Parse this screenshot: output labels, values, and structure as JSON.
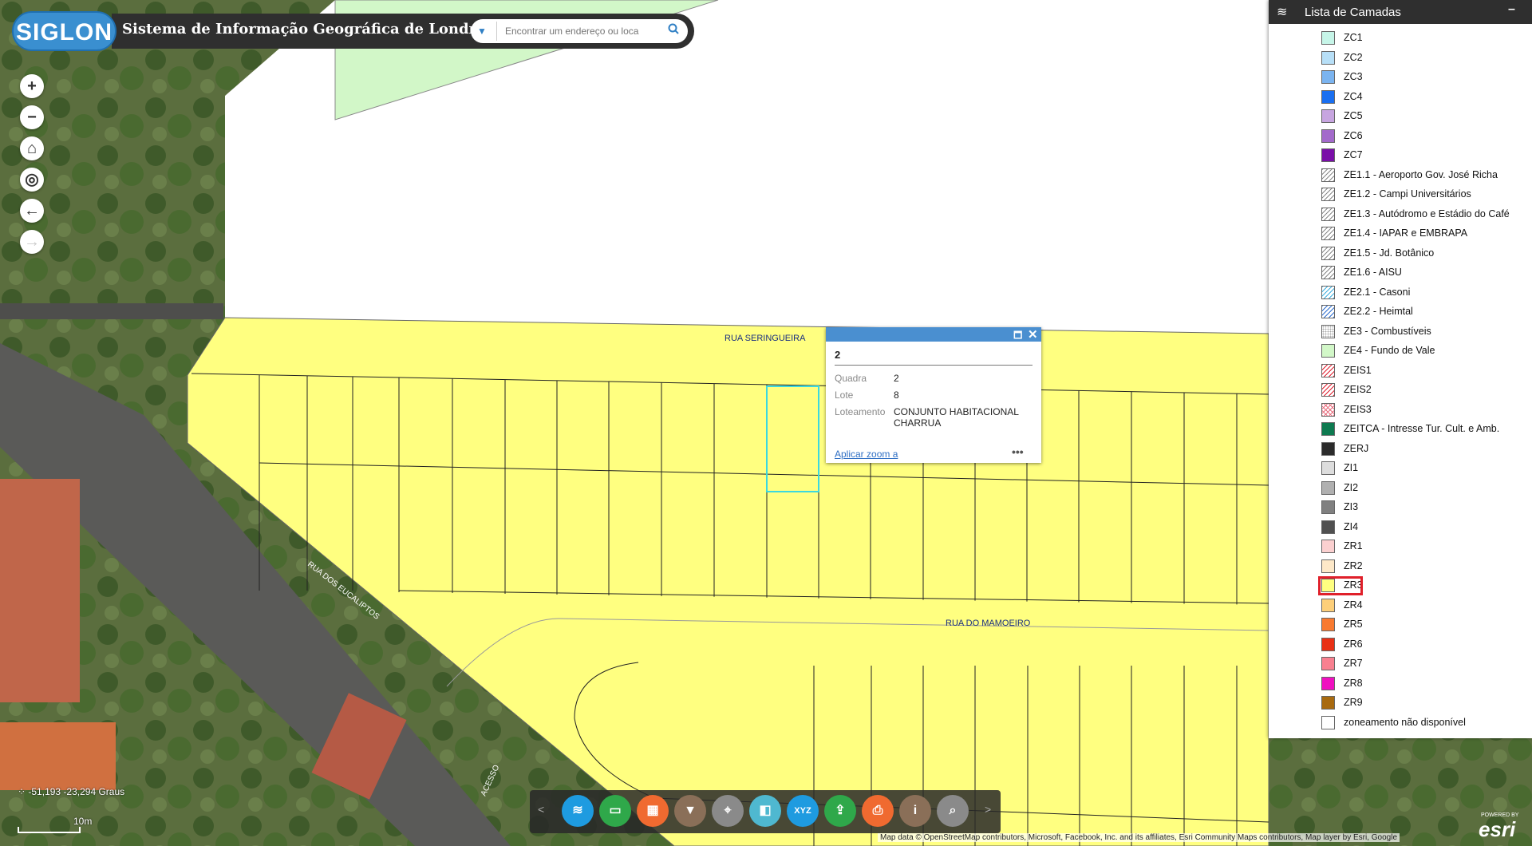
{
  "header": {
    "logo_text": "SIGLON",
    "title": "Sistema de Informação Geográfica de Londrina",
    "search_placeholder": "Encontrar um endereço ou loca",
    "search_dropdown_icon": "caret-down-icon",
    "search_icon": "search-icon"
  },
  "map_controls": [
    {
      "name": "zoom-in-button",
      "glyph": "+"
    },
    {
      "name": "zoom-out-button",
      "glyph": "−"
    },
    {
      "name": "home-button",
      "glyph": "⌂"
    },
    {
      "name": "locate-button",
      "glyph": "◎"
    },
    {
      "name": "back-extent-button",
      "glyph": "←"
    },
    {
      "name": "forward-extent-button",
      "glyph": "→"
    }
  ],
  "streets": {
    "seringueira": "RUA SERINGUEIRA",
    "mamoeiro": "RUA DO MAMOEIRO",
    "eucaliptos": "RUA DOS EUCALIPTOS",
    "acesso": "ACESSO"
  },
  "popup": {
    "title": "2",
    "fields": [
      {
        "key": "Quadra",
        "value": "2"
      },
      {
        "key": "Lote",
        "value": "8"
      },
      {
        "key": "Loteamento",
        "value": "CONJUNTO HABITACIONAL CHARRUA"
      }
    ],
    "zoom_link": "Aplicar zoom a",
    "more": "•••"
  },
  "layer_panel": {
    "title": "Lista de Camadas",
    "minimize": "–",
    "highlighted": "ZR3",
    "layers": [
      {
        "label": "ZC1",
        "color": "#c6f5e8",
        "pattern": "solid"
      },
      {
        "label": "ZC2",
        "color": "#b7dff7",
        "pattern": "solid"
      },
      {
        "label": "ZC3",
        "color": "#7bb4f0",
        "pattern": "solid"
      },
      {
        "label": "ZC4",
        "color": "#1a6ff0",
        "pattern": "solid"
      },
      {
        "label": "ZC5",
        "color": "#c7a5e0",
        "pattern": "solid"
      },
      {
        "label": "ZC6",
        "color": "#a36acb",
        "pattern": "solid"
      },
      {
        "label": "ZC7",
        "color": "#7a0fa8",
        "pattern": "solid"
      },
      {
        "label": "ZE1.1 - Aeroporto Gov. José Richa",
        "color": "#888888",
        "pattern": "hatch"
      },
      {
        "label": "ZE1.2 - Campi Universitários",
        "color": "#888888",
        "pattern": "hatch"
      },
      {
        "label": "ZE1.3 - Autódromo e Estádio do Café",
        "color": "#888888",
        "pattern": "hatch"
      },
      {
        "label": "ZE1.4 - IAPAR e EMBRAPA",
        "color": "#888888",
        "pattern": "hatch"
      },
      {
        "label": "ZE1.5 - Jd. Botânico",
        "color": "#888888",
        "pattern": "hatch"
      },
      {
        "label": "ZE1.6 - AISU",
        "color": "#888888",
        "pattern": "hatch"
      },
      {
        "label": "ZE2.1 - Casoni",
        "color": "#3fb0e0",
        "pattern": "hatch"
      },
      {
        "label": "ZE2.2 - Heimtal",
        "color": "#2f6fd0",
        "pattern": "hatch"
      },
      {
        "label": "ZE3 - Combustíveis",
        "color": "#aaaaaa",
        "pattern": "dots"
      },
      {
        "label": "ZE4 - Fundo de Vale",
        "color": "#d2f7c8",
        "pattern": "solid"
      },
      {
        "label": "ZEIS1",
        "color": "#e02030",
        "pattern": "hatch"
      },
      {
        "label": "ZEIS2",
        "color": "#e02030",
        "pattern": "hatch"
      },
      {
        "label": "ZEIS3",
        "color": "#e87080",
        "pattern": "cross"
      },
      {
        "label": "ZEITCA - Intresse Tur. Cult. e Amb.",
        "color": "#0e7a50",
        "pattern": "solid"
      },
      {
        "label": "ZERJ",
        "color": "#2b2b2b",
        "pattern": "solid"
      },
      {
        "label": "ZI1",
        "color": "#dddddd",
        "pattern": "solid"
      },
      {
        "label": "ZI2",
        "color": "#b0b0b0",
        "pattern": "solid"
      },
      {
        "label": "ZI3",
        "color": "#808080",
        "pattern": "solid"
      },
      {
        "label": "ZI4",
        "color": "#505050",
        "pattern": "solid"
      },
      {
        "label": "ZR1",
        "color": "#fbd0d0",
        "pattern": "solid"
      },
      {
        "label": "ZR2",
        "color": "#fde8c8",
        "pattern": "solid"
      },
      {
        "label": "ZR3",
        "color": "#ffff80",
        "pattern": "solid"
      },
      {
        "label": "ZR4",
        "color": "#fdcf7a",
        "pattern": "solid"
      },
      {
        "label": "ZR5",
        "color": "#f87a30",
        "pattern": "solid"
      },
      {
        "label": "ZR6",
        "color": "#e83015",
        "pattern": "solid"
      },
      {
        "label": "ZR7",
        "color": "#f88090",
        "pattern": "solid"
      },
      {
        "label": "ZR8",
        "color": "#f010c0",
        "pattern": "solid"
      },
      {
        "label": "ZR9",
        "color": "#a86a10",
        "pattern": "solid"
      },
      {
        "label": "zoneamento não disponível",
        "color": "#ffffff",
        "pattern": "solid"
      }
    ]
  },
  "status": {
    "coordinates": "-51,193 -23,294 Graus",
    "scale": "10m"
  },
  "toolbar": {
    "prev": "<",
    "next": ">",
    "tools": [
      {
        "name": "layers-tool-button",
        "color": "#1e9be0",
        "glyph": "≋"
      },
      {
        "name": "measure-tool-button",
        "color": "#2fa84a",
        "glyph": "▭"
      },
      {
        "name": "basemap-tool-button",
        "color": "#f06a30",
        "glyph": "▦"
      },
      {
        "name": "filter-tool-button",
        "color": "#8a6f58",
        "glyph": "▼"
      },
      {
        "name": "locate-tool-button",
        "color": "#8a8a8a",
        "glyph": "⌖"
      },
      {
        "name": "swipe-tool-button",
        "color": "#4fb8d0",
        "glyph": "◧"
      },
      {
        "name": "coordinate-tool-button",
        "color": "#1e9be0",
        "glyph": "XYZ"
      },
      {
        "name": "share-tool-button",
        "color": "#2fa84a",
        "glyph": "⇪"
      },
      {
        "name": "print-tool-button",
        "color": "#f06a30",
        "glyph": "⎙"
      },
      {
        "name": "info-tool-button",
        "color": "#8a6f58",
        "glyph": "i"
      },
      {
        "name": "query-tool-button",
        "color": "#8a8a8a",
        "glyph": "⌕"
      }
    ]
  },
  "attribution": "Map data © OpenStreetMap contributors, Microsoft, Facebook, Inc. and its affiliates, Esri Community Maps contributors, Map layer by Esri, Google",
  "esri": {
    "powered": "POWERED BY",
    "logo": "esri"
  },
  "colors": {
    "zone_fill": "#ffff80",
    "selected_parcel": "#3ad8e0",
    "panel_header": "#2f2f2f"
  }
}
